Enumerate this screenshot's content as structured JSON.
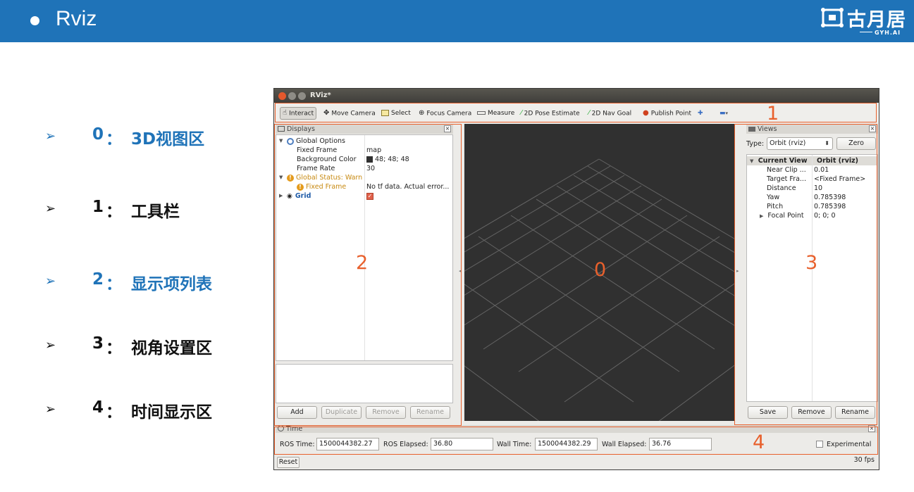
{
  "slide": {
    "title": "Rviz",
    "brand_text": "古月居",
    "brand_sub": "GYH.AI",
    "colors": {
      "header": "#1f73b8",
      "accent_orange": "#e8602c",
      "blue_text": "#1f73b8"
    }
  },
  "legend": [
    {
      "num": "0",
      "sep": "：",
      "label": "3D视图区",
      "color": "blue"
    },
    {
      "num": "1",
      "sep": "：",
      "label": "工具栏",
      "color": "black"
    },
    {
      "num": "2",
      "sep": "：",
      "label": "显示项列表",
      "color": "blue"
    },
    {
      "num": "3",
      "sep": "：",
      "label": "视角设置区",
      "color": "black"
    },
    {
      "num": "4",
      "sep": "：",
      "label": "时间显示区",
      "color": "black"
    }
  ],
  "window": {
    "title": "RViz*",
    "toolbar": {
      "interact": "Interact",
      "move_camera": "Move Camera",
      "select": "Select",
      "focus_camera": "Focus Camera",
      "measure": "Measure",
      "pose_estimate": "2D Pose Estimate",
      "nav_goal": "2D Nav Goal",
      "publish_point": "Publish Point"
    },
    "displays": {
      "title": "Displays",
      "global_options": "Global Options",
      "fixed_frame_label": "Fixed Frame",
      "fixed_frame_value": "map",
      "bg_color_label": "Background Color",
      "bg_color_value": "48; 48; 48",
      "frame_rate_label": "Frame Rate",
      "frame_rate_value": "30",
      "global_status": "Global Status: Warn",
      "status_fixed_frame": "Fixed Frame",
      "status_fixed_frame_value": "No tf data.  Actual error...",
      "grid": "Grid",
      "buttons": {
        "add": "Add",
        "duplicate": "Duplicate",
        "remove": "Remove",
        "rename": "Rename"
      }
    },
    "views": {
      "title": "Views",
      "type_label": "Type:",
      "type_value": "Orbit (rviz)",
      "zero": "Zero",
      "current_view": "Current View",
      "current_view_value": "Orbit (rviz)",
      "rows": [
        {
          "label": "Near Clip ...",
          "value": "0.01"
        },
        {
          "label": "Target Fra...",
          "value": "<Fixed Frame>"
        },
        {
          "label": "Distance",
          "value": "10"
        },
        {
          "label": "Yaw",
          "value": "0.785398"
        },
        {
          "label": "Pitch",
          "value": "0.785398"
        },
        {
          "label": "Focal Point",
          "value": "0; 0; 0"
        }
      ],
      "buttons": {
        "save": "Save",
        "remove": "Remove",
        "rename": "Rename"
      }
    },
    "time": {
      "title": "Time",
      "ros_time_label": "ROS Time:",
      "ros_time": "1500044382.27",
      "ros_elapsed_label": "ROS Elapsed:",
      "ros_elapsed": "36.80",
      "wall_time_label": "Wall Time:",
      "wall_time": "1500044382.29",
      "wall_elapsed_label": "Wall Elapsed:",
      "wall_elapsed": "36.76",
      "experimental": "Experimental",
      "reset": "Reset",
      "fps": "30 fps"
    }
  },
  "annotations": {
    "a0": "0",
    "a1": "1",
    "a2": "2",
    "a3": "3",
    "a4": "4"
  }
}
